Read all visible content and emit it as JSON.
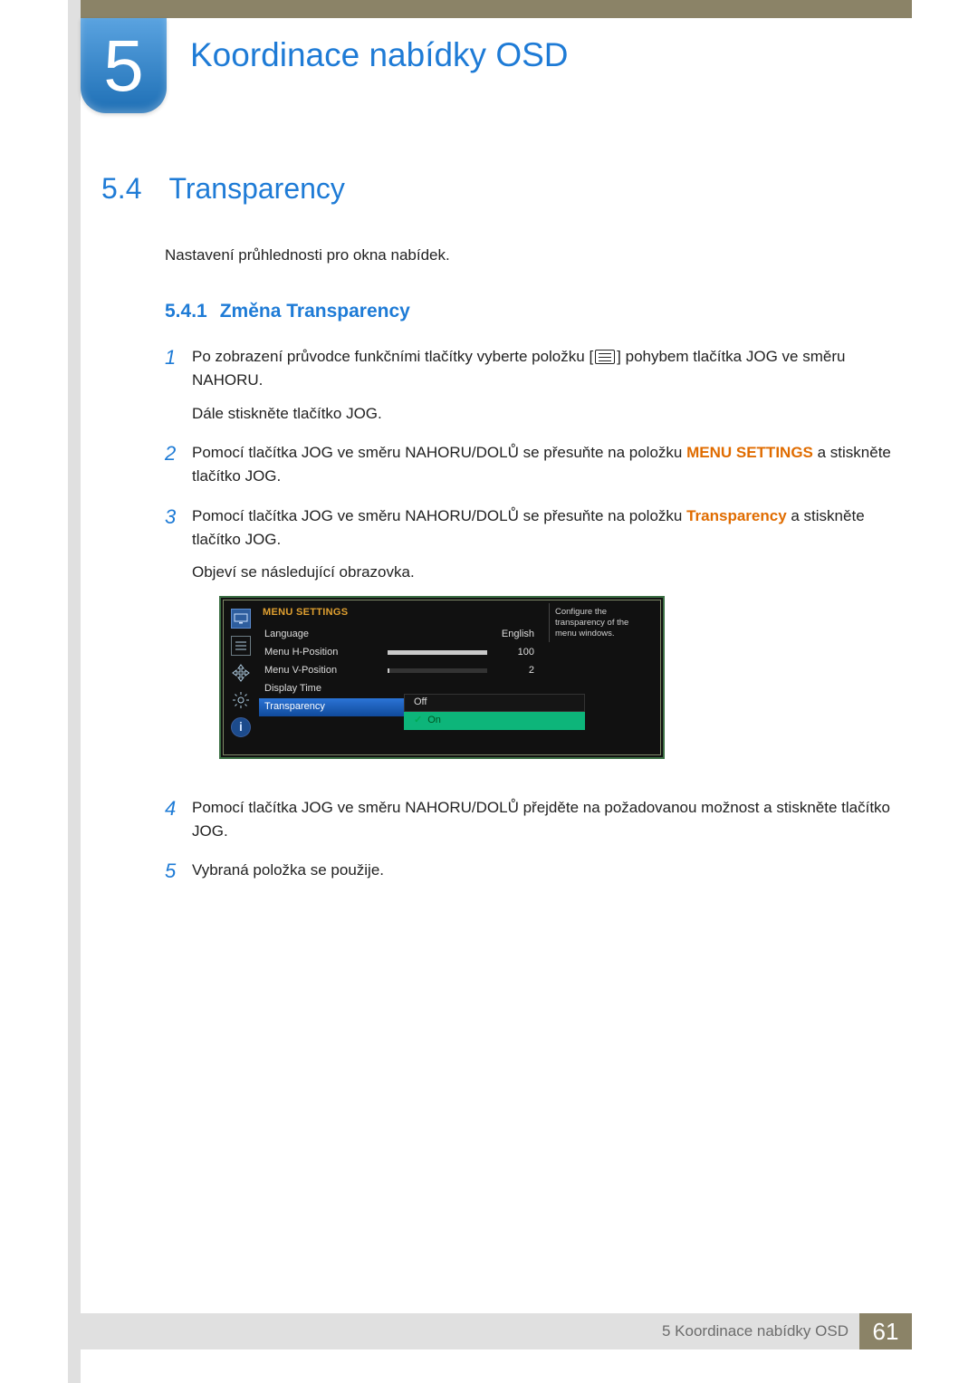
{
  "chapter": {
    "number": "5",
    "title": "Koordinace nabídky OSD"
  },
  "section": {
    "number": "5.4",
    "title": "Transparency"
  },
  "intro": "Nastavení průhlednosti pro okna nabídek.",
  "subsection": {
    "number": "5.4.1",
    "title": "Změna Transparency"
  },
  "steps": [
    {
      "n": "1",
      "pre": "Po zobrazení průvodce funkčními tlačítky vyberte položku [",
      "post": "] pohybem tlačítka JOG ve směru NAHORU.",
      "extra": "Dále stiskněte tlačítko JOG."
    },
    {
      "n": "2",
      "t1": "Pomocí tlačítka JOG ve směru NAHORU/DOLŮ se přesuňte na položku ",
      "kw": "MENU SETTINGS",
      "t2": " a stiskněte tlačítko JOG."
    },
    {
      "n": "3",
      "t1": "Pomocí tlačítka JOG ve směru NAHORU/DOLŮ se přesuňte na položku ",
      "kw": "Transparency",
      "t2": " a stiskněte tlačítko JOG.",
      "extra": "Objeví se následující obrazovka."
    },
    {
      "n": "4",
      "t1": "Pomocí tlačítka JOG ve směru NAHORU/DOLŮ přejděte na požadovanou možnost a stiskněte tlačítko JOG."
    },
    {
      "n": "5",
      "t1": "Vybraná položka se použije."
    }
  ],
  "osd": {
    "header": "MENU SETTINGS",
    "help": "Configure the transparency of the menu windows.",
    "rows": {
      "language": {
        "label": "Language",
        "value": "English"
      },
      "hpos": {
        "label": "Menu H-Position",
        "value": "100",
        "fill": 100
      },
      "vpos": {
        "label": "Menu V-Position",
        "value": "2",
        "fill": 2
      },
      "dtime": {
        "label": "Display Time"
      },
      "trans": {
        "label": "Transparency"
      }
    },
    "options": {
      "off": "Off",
      "on": "On"
    },
    "icons": {
      "i": "i"
    }
  },
  "footer": {
    "label": "5 Koordinace nabídky OSD",
    "page": "61"
  }
}
